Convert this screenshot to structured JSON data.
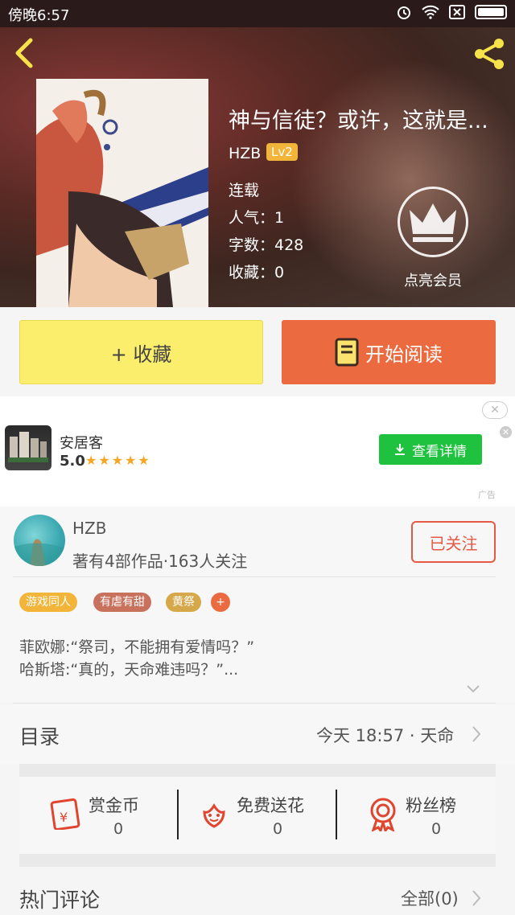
{
  "status": {
    "time": "傍晚6:57"
  },
  "book": {
    "title": "神与信徒？或许，这就是...",
    "author": "HZB",
    "level": "Lv2",
    "status": "连载",
    "popularity": "人气：1",
    "word_count": "字数：428",
    "favorites": "收藏：0",
    "vip_label": "点亮会员"
  },
  "actions": {
    "favorite_label": "+ 收藏",
    "read_label": "开始阅读"
  },
  "ad": {
    "app_name": "安居客",
    "rating": "5.0",
    "stars": "★★★★★",
    "button_label": "查看详情",
    "ad_tag": "广告"
  },
  "author_card": {
    "name": "HZB",
    "stats": "著有4部作品·163人关注",
    "follow_label": "已关注"
  },
  "tags": [
    {
      "label": "游戏同人",
      "color": "#f2b53a"
    },
    {
      "label": "有虐有甜",
      "color": "#c8715c"
    },
    {
      "label": "黄祭",
      "color": "#d6a84a"
    },
    {
      "label": "+",
      "color": "#ec6a3f"
    }
  ],
  "description": {
    "line1": "菲欧娜:“祭司，不能拥有爱情吗？”",
    "line2": "哈斯塔:“真的，天命难违吗？”..."
  },
  "catalog": {
    "title": "目录",
    "latest": "今天 18:57 · 天命"
  },
  "stats": [
    {
      "label": "赏金币",
      "value": "0",
      "icon": "red-envelope-icon"
    },
    {
      "label": "免费送花",
      "value": "0",
      "icon": "flower-icon"
    },
    {
      "label": "粉丝榜",
      "value": "0",
      "icon": "medal-icon"
    }
  ],
  "comments": {
    "title": "热门评论",
    "all_label": "全部(0)"
  },
  "colors": {
    "accent": "#ec6a3f",
    "favorite_bg": "#fbee6c",
    "ad_green": "#1fc23f",
    "follow_red": "#e55a45"
  }
}
